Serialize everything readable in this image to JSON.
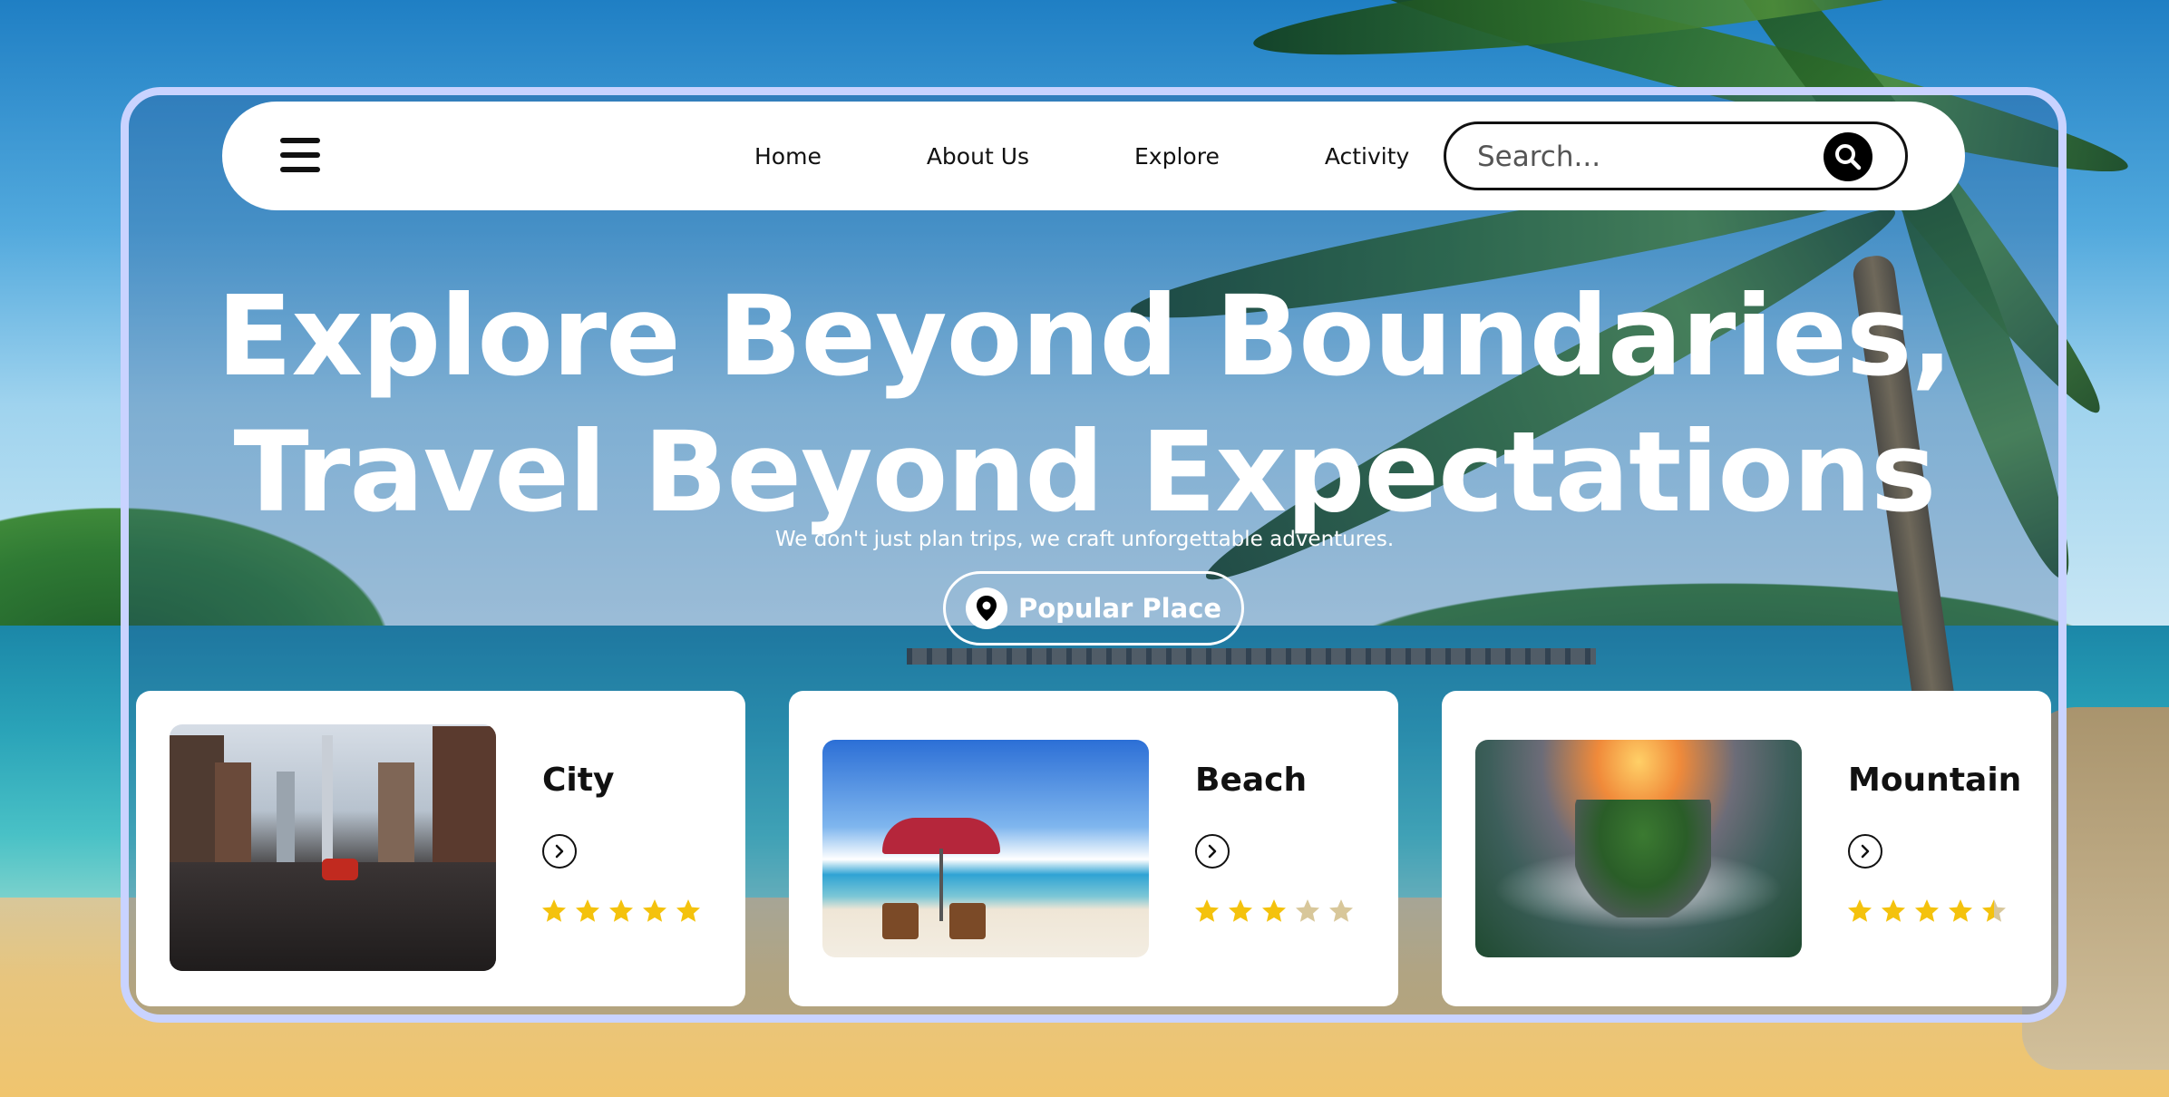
{
  "nav": {
    "links": [
      "Home",
      "About Us",
      "Explore",
      "Activity"
    ]
  },
  "search": {
    "placeholder": "Search..."
  },
  "hero": {
    "title_line1": "Explore Beyond Boundaries,",
    "title_line2": "Travel Beyond Expectations",
    "subtitle": "We don't just plan trips, we craft unforgettable adventures.",
    "cta_label": "Popular Place"
  },
  "cards": [
    {
      "name": "City",
      "rating": 5,
      "image": "city-street-photo"
    },
    {
      "name": "Beach",
      "rating": 3,
      "image": "beach-umbrella-photo"
    },
    {
      "name": "Mountain",
      "rating": 4.5,
      "image": "misty-mountain-sunrise-photo"
    }
  ],
  "colors": {
    "frame_border": "#c9d3ff",
    "star_filled": "#f4c20d",
    "star_empty": "#d8c79a"
  },
  "icons": {
    "menu": "hamburger-icon",
    "search": "magnifier-icon",
    "cta": "map-pin-icon",
    "card_action": "chevron-right-circle-icon",
    "rating": "star-icon"
  }
}
